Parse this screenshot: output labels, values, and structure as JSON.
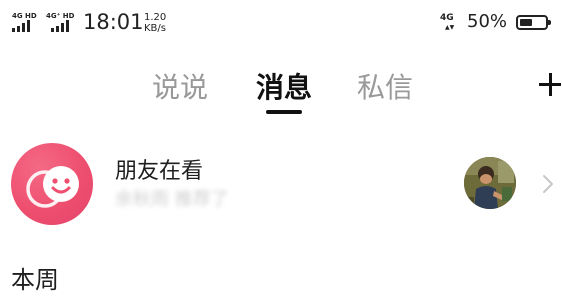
{
  "status_bar": {
    "signal_1_label": "4G HD",
    "signal_2_label": "4G⁺ HD",
    "time": "18:01",
    "net_speed_value": "1.20",
    "net_speed_unit": "KB/s",
    "network_label": "4G",
    "battery_percent": "50%",
    "battery_level": 0.5
  },
  "tabs": [
    {
      "label": "说说",
      "active": false
    },
    {
      "label": "消息",
      "active": true
    },
    {
      "label": "私信",
      "active": false
    }
  ],
  "header": {
    "add_icon": "plus-icon"
  },
  "friends_row": {
    "title": "朋友在看",
    "subtitle": "余秋雨 推荐了",
    "avatar_icon": "smiley-chat-bubble-icon",
    "avatar_color": "#ee4f6f",
    "chevron_icon": "chevron-right-icon"
  },
  "section": {
    "title": "本周"
  }
}
